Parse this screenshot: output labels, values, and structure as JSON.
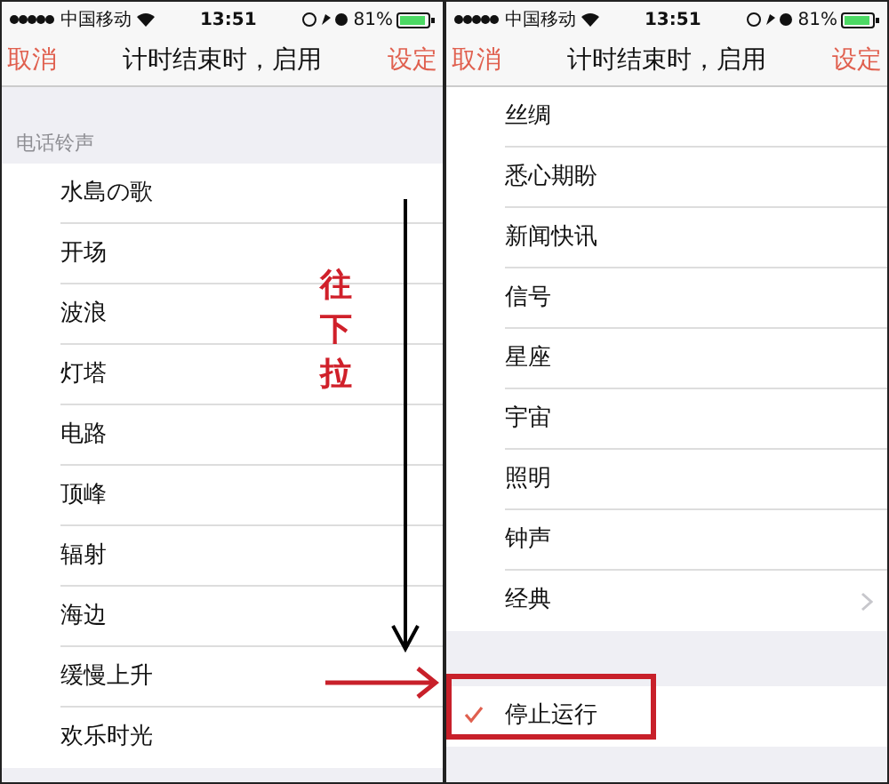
{
  "panels": [
    {
      "status_bar": {
        "carrier": "中国移动",
        "time": "13:51",
        "battery": "81%"
      },
      "nav": {
        "cancel": "取消",
        "title": "计时结束时，启用",
        "confirm": "设定"
      },
      "section_header": "电话铃声",
      "groups": [
        [
          {
            "label": "水島の歌",
            "checked": false,
            "chevron": false
          },
          {
            "label": "开场",
            "checked": false,
            "chevron": false
          },
          {
            "label": "波浪",
            "checked": false,
            "chevron": false
          },
          {
            "label": "灯塔",
            "checked": false,
            "chevron": false
          },
          {
            "label": "电路",
            "checked": false,
            "chevron": false
          },
          {
            "label": "顶峰",
            "checked": false,
            "chevron": false
          },
          {
            "label": "辐射",
            "checked": false,
            "chevron": false
          },
          {
            "label": "海边",
            "checked": false,
            "chevron": false
          },
          {
            "label": "缓慢上升",
            "checked": false,
            "chevron": false
          },
          {
            "label": "欢乐时光",
            "checked": false,
            "chevron": false
          }
        ]
      ]
    },
    {
      "status_bar": {
        "carrier": "中国移动",
        "time": "13:51",
        "battery": "81%"
      },
      "nav": {
        "cancel": "取消",
        "title": "计时结束时，启用",
        "confirm": "设定"
      },
      "groups": [
        [
          {
            "label": "丝绸",
            "checked": false,
            "chevron": false
          },
          {
            "label": "悉心期盼",
            "checked": false,
            "chevron": false
          },
          {
            "label": "新闻快讯",
            "checked": false,
            "chevron": false
          },
          {
            "label": "信号",
            "checked": false,
            "chevron": false
          },
          {
            "label": "星座",
            "checked": false,
            "chevron": false
          },
          {
            "label": "宇宙",
            "checked": false,
            "chevron": false
          },
          {
            "label": "照明",
            "checked": false,
            "chevron": false
          },
          {
            "label": "钟声",
            "checked": false,
            "chevron": false
          },
          {
            "label": "经典",
            "checked": false,
            "chevron": true
          }
        ],
        [
          {
            "label": "停止运行",
            "checked": true,
            "chevron": false
          }
        ]
      ]
    }
  ],
  "annotation_text": "往下拉"
}
